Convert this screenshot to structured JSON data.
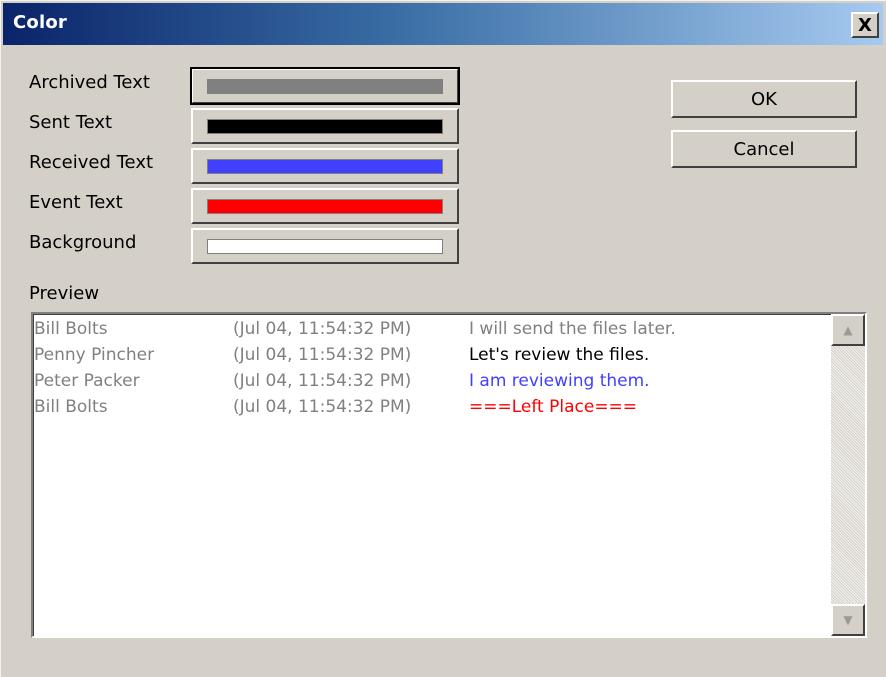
{
  "window": {
    "title": "Color",
    "close_glyph": "X"
  },
  "colors": [
    {
      "label": "Archived Text",
      "color": "#808080",
      "icon": "gray-swatch"
    },
    {
      "label": "Sent Text",
      "color": "#000000",
      "icon": "black-swatch"
    },
    {
      "label": "Received Text",
      "color": "#4040ff",
      "icon": "blue-swatch"
    },
    {
      "label": "Event Text",
      "color": "#ff0000",
      "icon": "red-swatch"
    },
    {
      "label": "Background",
      "color": "#ffffff",
      "icon": "white-swatch"
    }
  ],
  "buttons": {
    "ok": "OK",
    "cancel": "Cancel"
  },
  "preview": {
    "label": "Preview",
    "rows": [
      {
        "name": "Bill Bolts",
        "time": "(Jul 04, 11:54:32 PM)",
        "message": "I will send the files later.",
        "color": "#808080"
      },
      {
        "name": "Penny Pincher",
        "time": "(Jul 04, 11:54:32 PM)",
        "message": "Let's review the files.",
        "color": "#000000"
      },
      {
        "name": "Peter Packer",
        "time": "(Jul 04, 11:54:32 PM)",
        "message": "I am reviewing them.",
        "color": "#4040ff"
      },
      {
        "name": "Bill Bolts",
        "time": "(Jul 04, 11:54:32 PM)",
        "message": "===Left Place===",
        "color": "#ff0000"
      }
    ]
  },
  "scrollbar": {
    "up_glyph": "▲",
    "down_glyph": "▼"
  }
}
